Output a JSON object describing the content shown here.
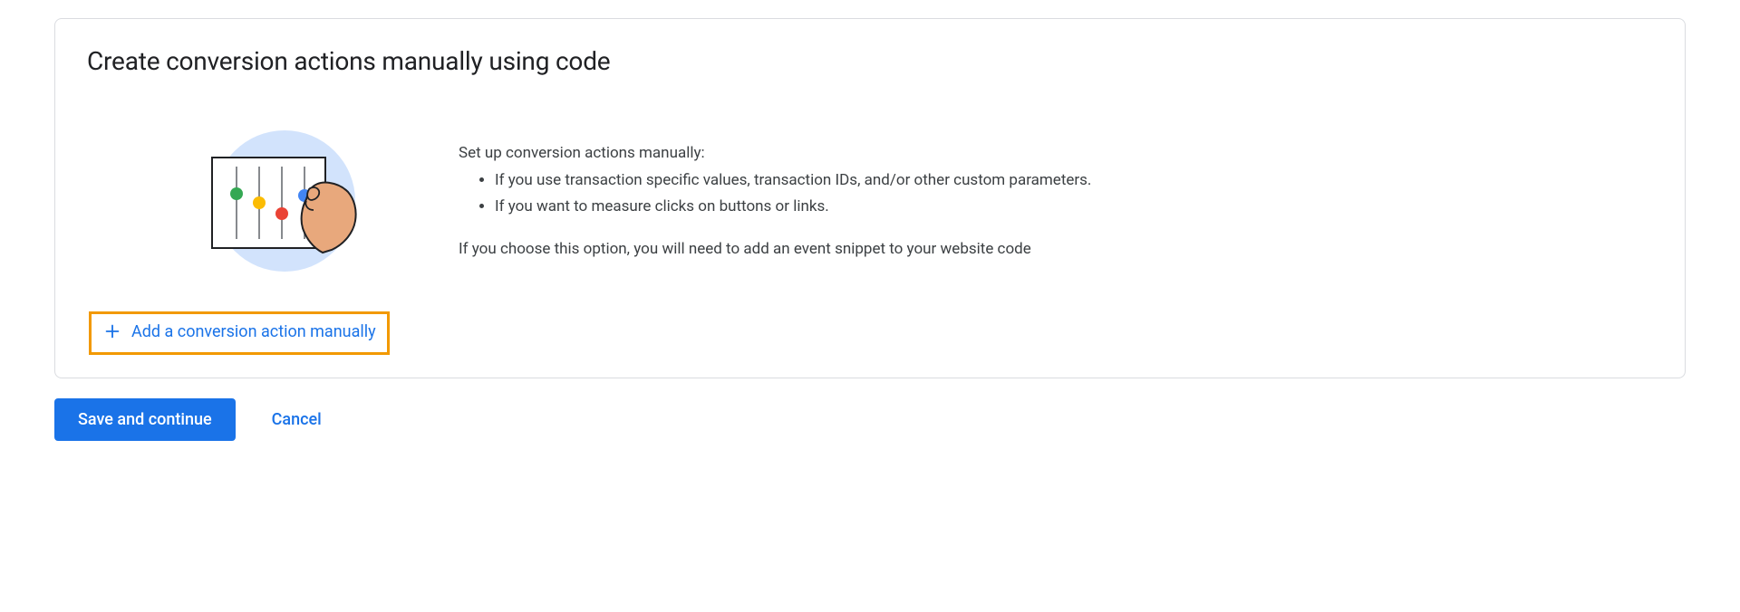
{
  "card": {
    "title": "Create conversion actions manually using code",
    "intro": "Set up conversion actions manually:",
    "bullets": [
      "If you use transaction specific values, transaction IDs, and/or other custom parameters.",
      "If you want to measure clicks on buttons or links."
    ],
    "note": "If you choose this option, you will need to add an event snippet to your website code",
    "add_button_label": "Add a conversion action manually"
  },
  "footer": {
    "save_label": "Save and continue",
    "cancel_label": "Cancel"
  },
  "colors": {
    "primary": "#1a73e8",
    "highlight_border": "#f29900"
  }
}
